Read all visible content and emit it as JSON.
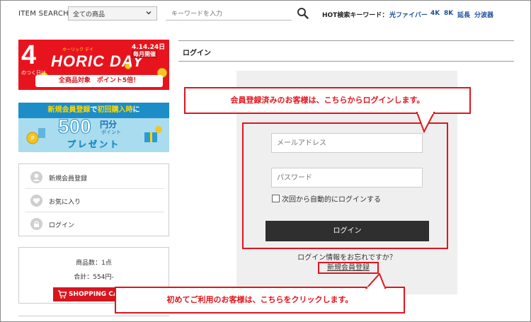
{
  "header": {
    "item_search_label": "ITEM SEARCH",
    "category_selected": "全ての商品",
    "keyword_placeholder": "キーワードを入力",
    "hot_label": "HOT検索キーワード：",
    "hot_keywords": [
      "光ファイバー",
      "4K",
      "8K",
      "延長",
      "分波器"
    ]
  },
  "banners": {
    "horic": {
      "big_number": "4",
      "small_text": "のつく日は",
      "ruby": "ホーリック デイ",
      "title": "HORIC DAY",
      "date": "4.14.24日",
      "monthly": "毎月開催",
      "bottom": "全商品対象　ポイント5倍！"
    },
    "points": {
      "top_a": "新規会員登録",
      "top_b": "で",
      "top_c": "初回購入時",
      "top_d": "に",
      "amount": "500",
      "unit": "円分",
      "unit_sub": "ポイント",
      "present": "プレゼント"
    }
  },
  "user_menu": {
    "items": [
      {
        "label": "新規会員登録",
        "icon": "user-icon"
      },
      {
        "label": "お気に入り",
        "icon": "heart-icon"
      },
      {
        "label": "ログイン",
        "icon": "lock-icon"
      }
    ]
  },
  "cart": {
    "count": "商品数：1点",
    "total": "合計：554円-",
    "button_label": "SHOPPING CART"
  },
  "main": {
    "heading": "ログイン",
    "email_placeholder": "メールアドレス",
    "password_placeholder": "パスワード",
    "remember_label": "次回から自動的にログインする",
    "login_button": "ログイン",
    "forgot_text": "ログイン情報をお忘れですか？",
    "signup_link": "新規会員登録"
  },
  "callouts": {
    "members": "会員登録済みのお客様は、こちらからログインします。",
    "new_users": "初めてご利用のお客様は、こちらをクリックします。"
  },
  "colors": {
    "accent_red": "#e2141d",
    "link_blue": "#1e4ea0",
    "button_dark": "#2f2f2f",
    "banner_blue": "#1d8dc7"
  }
}
